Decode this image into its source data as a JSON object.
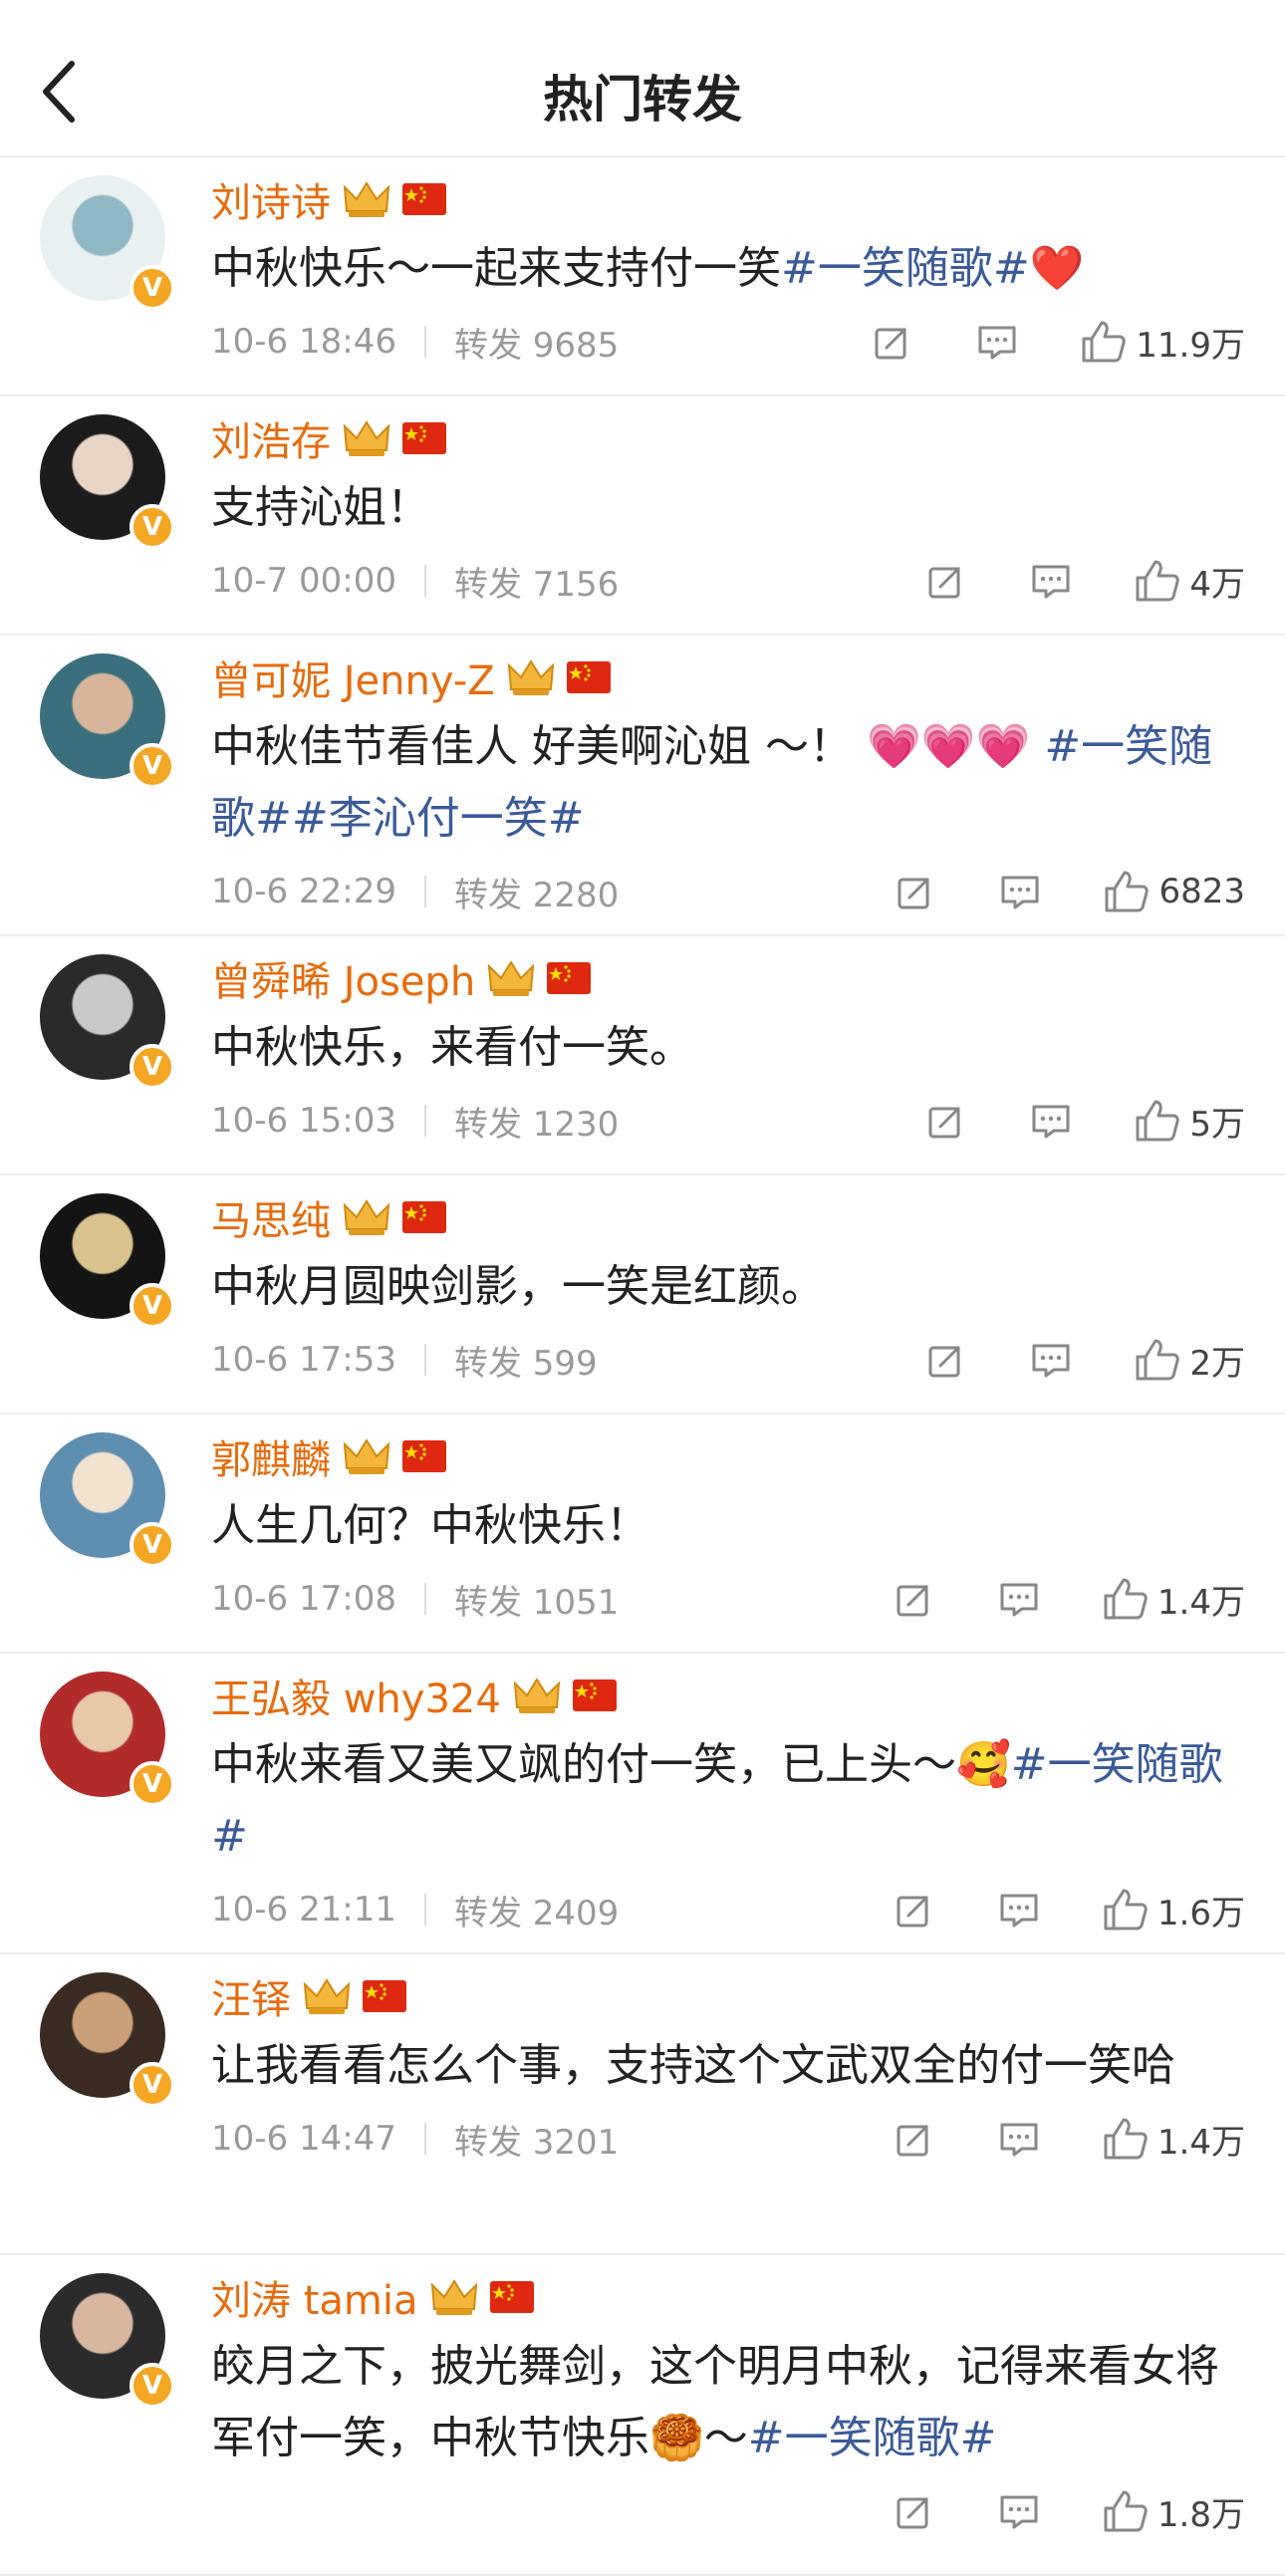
{
  "header": {
    "title": "热门转发"
  },
  "items": [
    {
      "name": "刘诗诗",
      "text_parts": [
        {
          "t": "中秋快乐～一起来支持付一笑"
        },
        {
          "t": "#一笑随歌#",
          "tag": true
        },
        {
          "t": "❤️"
        }
      ],
      "time": "10-6 18:46",
      "repost": "转发 9685",
      "likes": "11.9万",
      "av": [
        "#e9f0f2",
        "#8fb7c4"
      ]
    },
    {
      "name": "刘浩存",
      "text_parts": [
        {
          "t": "支持沁姐！"
        }
      ],
      "time": "10-7 00:00",
      "repost": "转发 7156",
      "likes": "4万",
      "av": [
        "#1b1b1b",
        "#e8d5c6"
      ]
    },
    {
      "name": "曾可妮 Jenny-Z",
      "text_parts": [
        {
          "t": "中秋佳节看佳人 好美啊沁姐 ～！ 💗💗💗 "
        },
        {
          "t": "#一笑随歌##李沁付一笑#",
          "tag": true
        }
      ],
      "time": "10-6 22:29",
      "repost": "转发 2280",
      "likes": "6823",
      "av": [
        "#3c6f7d",
        "#d7b59a"
      ]
    },
    {
      "name": "曾舜晞 Joseph",
      "text_parts": [
        {
          "t": "中秋快乐，来看付一笑。"
        }
      ],
      "time": "10-6 15:03",
      "repost": "转发 1230",
      "likes": "5万",
      "av": [
        "#2a2a2a",
        "#c9c9c9"
      ]
    },
    {
      "name": "马思纯",
      "text_parts": [
        {
          "t": "中秋月圆映剑影，一笑是红颜。"
        }
      ],
      "time": "10-6 17:53",
      "repost": "转发 599",
      "likes": "2万",
      "av": [
        "#141414",
        "#d8c28e"
      ]
    },
    {
      "name": "郭麒麟",
      "text_parts": [
        {
          "t": "人生几何？中秋快乐！"
        }
      ],
      "time": "10-6 17:08",
      "repost": "转发 1051",
      "likes": "1.4万",
      "av": [
        "#5f8fb0",
        "#f2e2d0"
      ]
    },
    {
      "name": "王弘毅 why324",
      "text_parts": [
        {
          "t": "中秋来看又美又飒的付一笑，已上头～🥰"
        },
        {
          "t": "#一笑随歌#",
          "tag": true
        }
      ],
      "time": "10-6 21:11",
      "repost": "转发 2409",
      "likes": "1.6万",
      "av": [
        "#b22b2b",
        "#e6c9a8"
      ]
    },
    {
      "name": "汪铎",
      "text_parts": [
        {
          "t": "让我看看怎么个事，支持这个文武双全的付一笑哈"
        }
      ],
      "time": "10-6 14:47",
      "repost": "转发 3201",
      "likes": "1.4万",
      "av": [
        "#3a2c22",
        "#caa07a"
      ]
    },
    {
      "name": "刘涛 tamia",
      "text_parts": [
        {
          "t": "皎月之下，披光舞剑，这个明月中秋，记得来看女将军付一笑，中秋节快乐🥮～"
        },
        {
          "t": "#一笑随歌#",
          "tag": true
        }
      ],
      "time": "",
      "repost": "",
      "likes": "1.8万",
      "av": [
        "#2b2b2b",
        "#d7b7a0"
      ]
    }
  ],
  "icons": {
    "back": "chevron-left-icon",
    "crown": "crown-badge-icon",
    "flag": "china-flag-icon",
    "repost": "repost-icon",
    "comment": "comment-icon",
    "like": "thumbs-up-icon"
  },
  "colors": {
    "name": "#e86b0c",
    "tag": "#3a5b9a",
    "meta": "#9a9a9a"
  }
}
